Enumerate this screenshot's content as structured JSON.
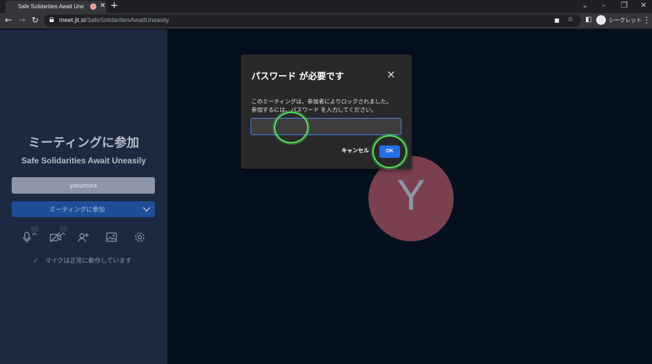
{
  "browser": {
    "tab_title": "Safe Solidarities Await Uneasily",
    "tab_close": "✕",
    "new_tab": "+",
    "url_host": "meet.jit.si",
    "url_path": "/SafeSolidaritiesAwaitUneasily",
    "profile_label": "シークレット"
  },
  "prejoin": {
    "title": "ミーティングに参加",
    "room_name": "Safe Solidarities Await Uneasily",
    "display_name": "yasumura",
    "join_label": "ミーティングに参加",
    "mic_status": "マイクは正常に動作しています"
  },
  "avatar": {
    "letter": "Y",
    "color": "#7a4050"
  },
  "dialog": {
    "title": "パスワード が必要です",
    "message_line1": "このミーティングは、参加者によりロックされました。",
    "message_line2": "参加するには、パスワード を入力してください。",
    "password_value": "",
    "cancel_label": "キャンセル",
    "ok_label": "OK"
  },
  "colors": {
    "accent": "#246fe5",
    "focus_ring": "#55e05a"
  }
}
